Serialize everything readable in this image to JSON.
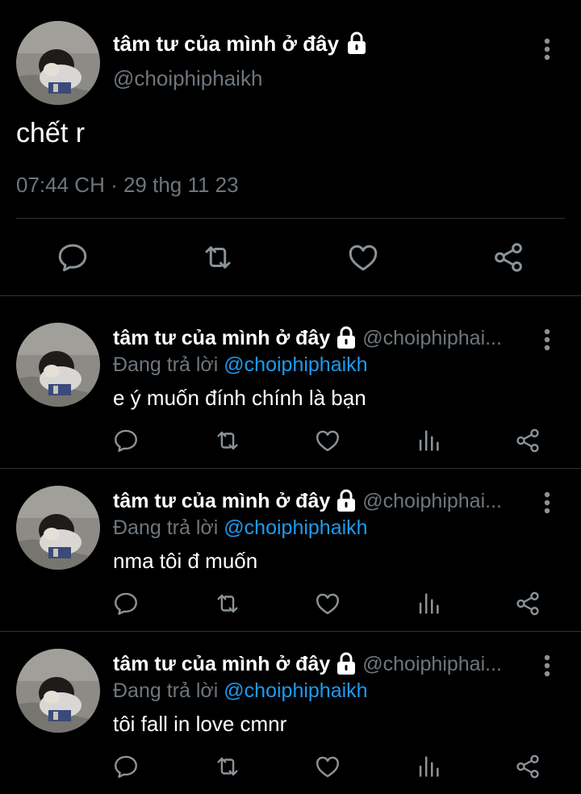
{
  "main_tweet": {
    "display_name": "tâm tư của mình ở đây",
    "handle": "@choiphiphaikh",
    "text": "chết r",
    "timestamp": "07:44 CH · 29 thg 11 23",
    "icons": {
      "lock": "lock-icon",
      "more": "more-vertical-icon",
      "reply": "reply-icon",
      "retweet": "retweet-icon",
      "like": "heart-icon",
      "share": "share-icon"
    }
  },
  "replies": [
    {
      "display_name": "tâm tư của mình ở đây",
      "handle": "@choiphiphai...",
      "replying_prefix": "Đang trả lời",
      "replying_to": "@choiphiphaikh",
      "text": "e ý muốn đính chính là bạn"
    },
    {
      "display_name": "tâm tư của mình ở đây",
      "handle": "@choiphiphai...",
      "replying_prefix": "Đang trả lời",
      "replying_to": "@choiphiphaikh",
      "text": "nma tôi đ muốn"
    },
    {
      "display_name": "tâm tư của mình ở đây",
      "handle": "@choiphiphai...",
      "replying_prefix": "Đang trả lời",
      "replying_to": "@choiphiphaikh",
      "text": "tôi fall in love cmnr"
    }
  ],
  "colors": {
    "background": "#000000",
    "text": "#ffffff",
    "muted": "#6e767d",
    "link": "#1d9bf0",
    "divider": "#2f3336"
  }
}
